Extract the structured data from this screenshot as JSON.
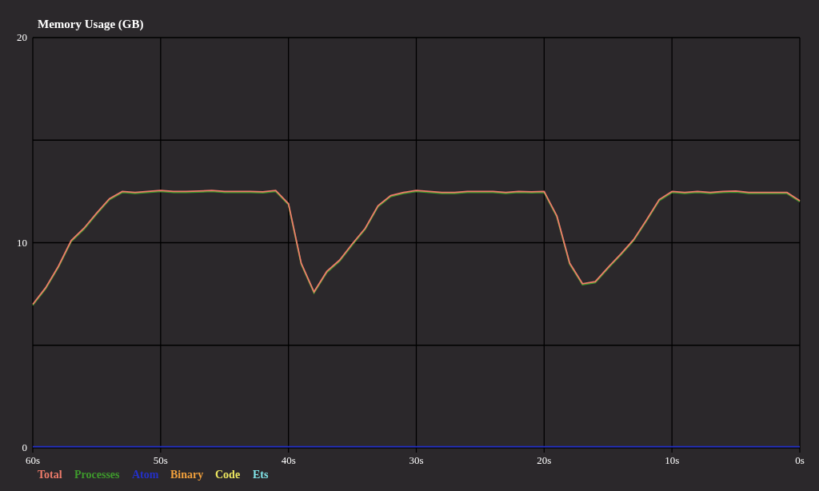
{
  "chart_data": {
    "type": "line",
    "title": "Memory Usage (GB)",
    "x": [
      60,
      59,
      58,
      57,
      56,
      55,
      54,
      53,
      52,
      51,
      50,
      49,
      48,
      47,
      46,
      45,
      44,
      43,
      42,
      41,
      40,
      39,
      38,
      37,
      36,
      35,
      34,
      33,
      32,
      31,
      30,
      29,
      28,
      27,
      26,
      25,
      24,
      23,
      22,
      21,
      20,
      19,
      18,
      17,
      16,
      15,
      14,
      13,
      12,
      11,
      10,
      9,
      8,
      7,
      6,
      5,
      4,
      3,
      2,
      1,
      0
    ],
    "xlim": [
      60,
      0
    ],
    "ylim": [
      0,
      20
    ],
    "xticks": [
      {
        "value": 60,
        "label": "60s"
      },
      {
        "value": 50,
        "label": "50s"
      },
      {
        "value": 40,
        "label": "40s"
      },
      {
        "value": 30,
        "label": "30s"
      },
      {
        "value": 20,
        "label": "20s"
      },
      {
        "value": 10,
        "label": "10s"
      },
      {
        "value": 0,
        "label": "0s"
      }
    ],
    "yticks": [
      0,
      10,
      20
    ],
    "series": [
      {
        "name": "Total",
        "color": "#ee7b6a",
        "values": [
          7.0,
          7.8,
          8.85,
          10.1,
          10.7,
          11.45,
          12.15,
          12.5,
          12.45,
          12.5,
          12.55,
          12.5,
          12.5,
          12.52,
          12.55,
          12.5,
          12.5,
          12.5,
          12.48,
          12.55,
          11.9,
          9.0,
          7.6,
          8.6,
          9.15,
          9.95,
          10.7,
          11.8,
          12.3,
          12.45,
          12.55,
          12.5,
          12.45,
          12.45,
          12.5,
          12.5,
          12.5,
          12.45,
          12.5,
          12.48,
          12.5,
          11.3,
          9.0,
          8.0,
          8.1,
          8.8,
          9.45,
          10.15,
          11.1,
          12.1,
          12.5,
          12.45,
          12.5,
          12.45,
          12.5,
          12.52,
          12.45,
          12.45,
          12.45,
          12.45,
          12.05
        ]
      },
      {
        "name": "Processes",
        "color": "#3e9a2c",
        "values": [
          6.95,
          7.75,
          8.8,
          10.05,
          10.65,
          11.4,
          12.1,
          12.45,
          12.4,
          12.45,
          12.5,
          12.45,
          12.45,
          12.47,
          12.5,
          12.45,
          12.45,
          12.45,
          12.43,
          12.5,
          11.85,
          8.95,
          7.55,
          8.55,
          9.1,
          9.9,
          10.65,
          11.75,
          12.25,
          12.4,
          12.5,
          12.45,
          12.4,
          12.4,
          12.45,
          12.45,
          12.45,
          12.4,
          12.45,
          12.43,
          12.45,
          11.25,
          8.95,
          7.95,
          8.05,
          8.75,
          9.4,
          10.1,
          11.05,
          12.05,
          12.45,
          12.4,
          12.45,
          12.4,
          12.45,
          12.47,
          12.4,
          12.4,
          12.4,
          12.4,
          12.0
        ]
      },
      {
        "name": "Atom",
        "color": "#2430c8",
        "values": [
          0.05,
          0.05,
          0.05,
          0.05,
          0.05,
          0.05,
          0.05,
          0.05,
          0.05,
          0.05,
          0.05,
          0.05,
          0.05,
          0.05,
          0.05,
          0.05,
          0.05,
          0.05,
          0.05,
          0.05,
          0.05,
          0.05,
          0.05,
          0.05,
          0.05,
          0.05,
          0.05,
          0.05,
          0.05,
          0.05,
          0.05,
          0.05,
          0.05,
          0.05,
          0.05,
          0.05,
          0.05,
          0.05,
          0.05,
          0.05,
          0.05,
          0.05,
          0.05,
          0.05,
          0.05,
          0.05,
          0.05,
          0.05,
          0.05,
          0.05,
          0.05,
          0.05,
          0.05,
          0.05,
          0.05,
          0.05,
          0.05,
          0.05,
          0.05,
          0.05,
          0.05
        ]
      },
      {
        "name": "Binary",
        "color": "#f2a03c",
        "values": [
          null,
          null,
          null,
          null,
          null,
          null,
          null,
          null,
          null,
          null,
          null,
          null,
          null,
          null,
          null,
          null,
          null,
          null,
          null,
          null,
          null,
          null,
          null,
          null,
          null,
          null,
          null,
          null,
          null,
          null,
          null,
          null,
          null,
          null,
          null,
          null,
          null,
          null,
          null,
          null,
          null,
          null,
          null,
          null,
          null,
          null,
          null,
          null,
          null,
          null,
          null,
          null,
          null,
          null,
          null,
          null,
          null,
          null,
          null,
          null,
          null
        ]
      },
      {
        "name": "Code",
        "color": "#eee860",
        "values": [
          null,
          null,
          null,
          null,
          null,
          null,
          null,
          null,
          null,
          null,
          null,
          null,
          null,
          null,
          null,
          null,
          null,
          null,
          null,
          null,
          null,
          null,
          null,
          null,
          null,
          null,
          null,
          null,
          null,
          null,
          null,
          null,
          null,
          null,
          null,
          null,
          null,
          null,
          null,
          null,
          null,
          null,
          null,
          null,
          null,
          null,
          null,
          null,
          null,
          null,
          null,
          null,
          null,
          null,
          null,
          null,
          null,
          null,
          null,
          null,
          null
        ]
      },
      {
        "name": "Ets",
        "color": "#80e4e8",
        "values": [
          null,
          null,
          null,
          null,
          null,
          null,
          null,
          null,
          null,
          null,
          null,
          null,
          null,
          null,
          null,
          null,
          null,
          null,
          null,
          null,
          null,
          null,
          null,
          null,
          null,
          null,
          null,
          null,
          null,
          null,
          null,
          null,
          null,
          null,
          null,
          null,
          null,
          null,
          null,
          null,
          null,
          null,
          null,
          null,
          null,
          null,
          null,
          null,
          null,
          null,
          null,
          null,
          null,
          null,
          null,
          null,
          null,
          null,
          null,
          null,
          null
        ]
      }
    ],
    "grid": true
  }
}
